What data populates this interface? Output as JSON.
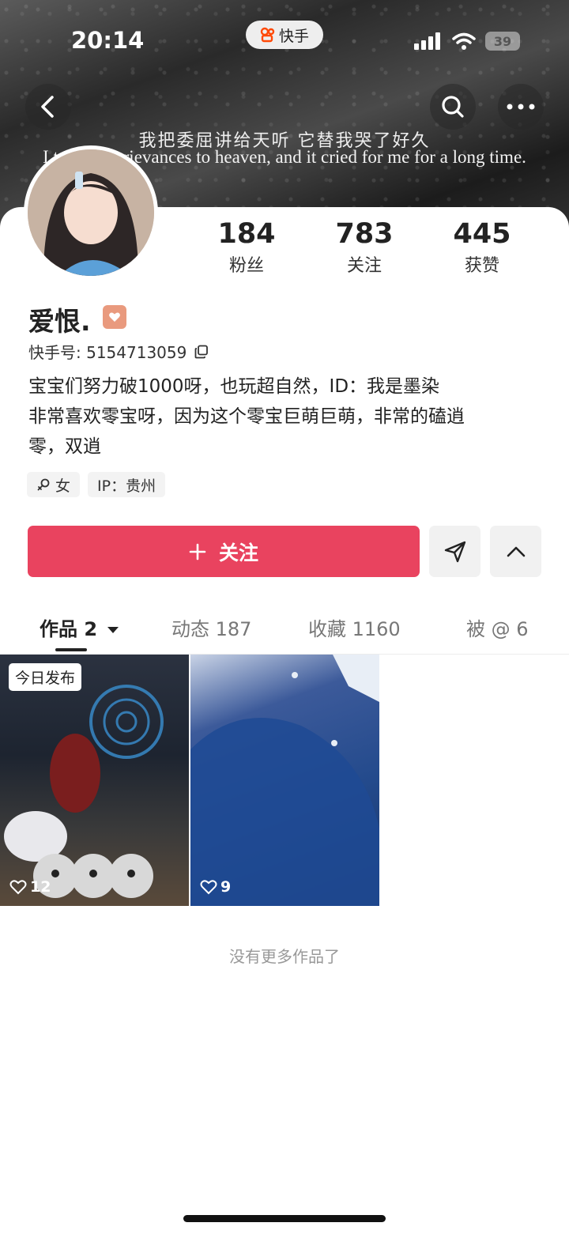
{
  "status_bar": {
    "time": "20:14",
    "app_name": "快手",
    "battery": "39"
  },
  "banner": {
    "line_cn": "我把委屈讲给天听 它替我哭了好久",
    "line_en": "I told my grievances to heaven, and it cried for me for a long time."
  },
  "nav": {
    "back_icon": "chevron-left-icon",
    "search_icon": "search-icon",
    "more_icon": "more-icon"
  },
  "stats": [
    {
      "value": "184",
      "label": "粉丝"
    },
    {
      "value": "783",
      "label": "关注"
    },
    {
      "value": "445",
      "label": "获赞"
    }
  ],
  "profile": {
    "name": "爱恨.",
    "id_text": "快手号: 5154713059",
    "bio": [
      "宝宝们努力破1000呀，也玩超自然，ID：我是墨染",
      "非常喜欢零宝呀，因为这个零宝巨萌巨萌，非常的磕逍",
      "零，双逍"
    ],
    "tags": {
      "gender": "女",
      "ip": "IP：贵州"
    }
  },
  "actions": {
    "follow_label": "关注",
    "follow_icon": "plus-icon",
    "share_icon": "send-icon",
    "collapse_icon": "chevron-up-icon"
  },
  "tabs": [
    {
      "label": "作品 2"
    },
    {
      "label": "动态 187"
    },
    {
      "label": "收藏 1160"
    },
    {
      "label": "被 @ 6"
    }
  ],
  "works": [
    {
      "badge": "今日发布",
      "likes": "12"
    },
    {
      "likes": "9"
    }
  ],
  "footer": {
    "no_more": "没有更多作品了"
  },
  "colors": {
    "accent": "#e9435f"
  }
}
